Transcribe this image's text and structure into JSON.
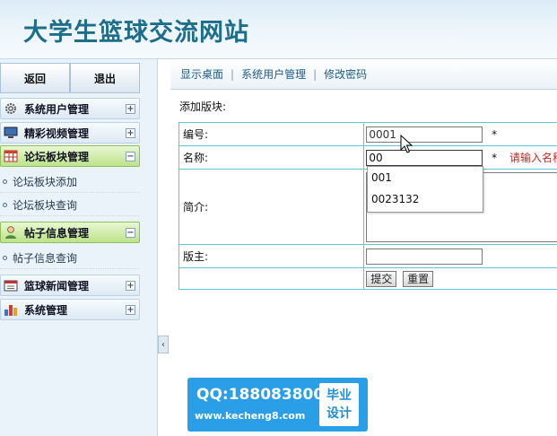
{
  "header": {
    "title": "大学生篮球交流网站"
  },
  "sidebar": {
    "top_buttons": {
      "back": "返回",
      "logout": "退出"
    },
    "groups": [
      {
        "label": "系统用户管理",
        "icon": "gear-icon",
        "expanded": false,
        "toggle": "+"
      },
      {
        "label": "精彩视频管理",
        "icon": "monitor-icon",
        "expanded": false,
        "toggle": "+"
      },
      {
        "label": "论坛板块管理",
        "icon": "table-icon",
        "expanded": true,
        "toggle": "−",
        "items": [
          "论坛板块添加",
          "论坛板块查询"
        ]
      },
      {
        "label": "帖子信息管理",
        "icon": "user-icon",
        "expanded": true,
        "toggle": "−",
        "items": [
          "帖子信息查询"
        ]
      },
      {
        "label": "篮球新闻管理",
        "icon": "calendar-icon",
        "expanded": false,
        "toggle": "+"
      },
      {
        "label": "系统管理",
        "icon": "bar-chart-icon",
        "expanded": false,
        "toggle": "+"
      }
    ],
    "collapse_glyph": "‹"
  },
  "nav": {
    "items": [
      "显示桌面",
      "系统用户管理",
      "修改密码"
    ],
    "separator": "|"
  },
  "form": {
    "section_label": "添加版块:",
    "fields": {
      "code": {
        "label": "编号:",
        "value": "0001",
        "required": "*"
      },
      "name": {
        "label": "名称:",
        "value": "00",
        "required": "*",
        "hint": "请输入名称"
      },
      "intro": {
        "label": "简介:"
      },
      "moderator": {
        "label": "版主:",
        "value": ""
      }
    },
    "autocomplete": [
      "001",
      "0023132"
    ],
    "submit_label": "提交",
    "reset_label": "重置"
  },
  "watermark": {
    "qq": "QQ:188083800",
    "url": "www.kecheng8.com",
    "badge_line1": "毕业",
    "badge_line2": "设计"
  },
  "colors": {
    "accent": "#1d6e8b",
    "link": "#1c5d86",
    "table_border": "#5fc7d0",
    "hint": "#c0281e",
    "watermark": "#2a9ee6"
  }
}
